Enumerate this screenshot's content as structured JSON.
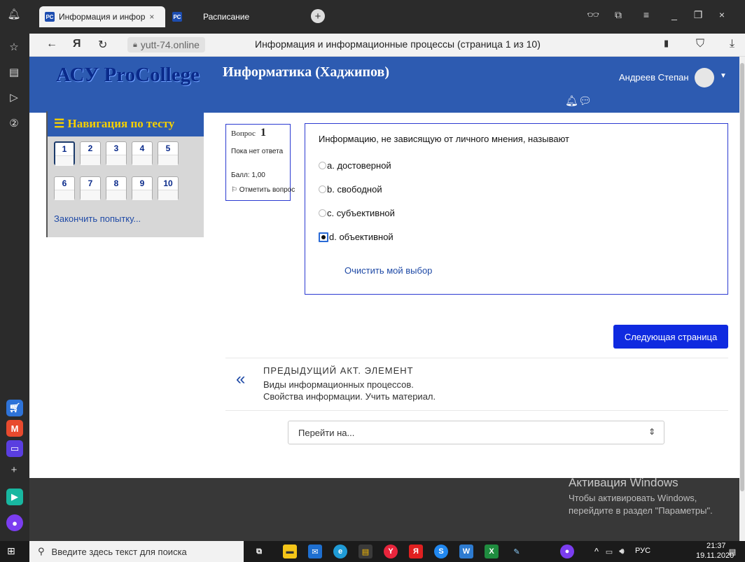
{
  "browser": {
    "tabs": [
      {
        "favicon": "РС",
        "label": "Информация и инфор",
        "close": "×"
      },
      {
        "favicon": "РС",
        "label": ""
      },
      {
        "label": "Расписание"
      }
    ],
    "new_tab": "+",
    "url": "yutt-74.online",
    "page_title": "Информация и информационные процессы (страница 1 из 10)"
  },
  "header": {
    "logo": "АСУ ProCollege",
    "course_title": "Информатика (Хаджипов)",
    "user_name": "Андреев Степан"
  },
  "quiz_nav": {
    "title": "Навигация по тесту",
    "questions": [
      "1",
      "2",
      "3",
      "4",
      "5",
      "6",
      "7",
      "8",
      "9",
      "10"
    ],
    "finish_link": "Закончить попытку..."
  },
  "question_info": {
    "label": "Вопрос",
    "number": "1",
    "status": "Пока нет ответа",
    "score": "Балл: 1,00",
    "flag": "Отметить вопрос"
  },
  "question": {
    "text": "Информацию, не зависящую от личного мнения, называют",
    "answers": [
      {
        "label": "a. достоверной",
        "selected": false
      },
      {
        "label": "b. свободной",
        "selected": false
      },
      {
        "label": "c. субъективной",
        "selected": false
      },
      {
        "label": "d. объективной",
        "selected": true
      }
    ],
    "clear_choice": "Очистить мой выбор"
  },
  "next_button": "Следующая страница",
  "prev_activity": {
    "arrow": "«",
    "heading": "ПРЕДЫДУЩИЙ АКТ. ЭЛЕМЕНТ",
    "line1": "Виды информационных процессов.",
    "line2": "Свойства информации. Учить материал."
  },
  "jump_to": {
    "placeholder": "Перейти на...",
    "caret": "⇕"
  },
  "watermark": {
    "title": "Активация Windows",
    "line1": "Чтобы активировать Windows,",
    "line2": "перейдите в раздел \"Параметры\"."
  },
  "taskbar": {
    "search_placeholder": "Введите здесь текст для поиска",
    "tray": "РУС",
    "time": "21:37",
    "date": "19.11.2020"
  }
}
